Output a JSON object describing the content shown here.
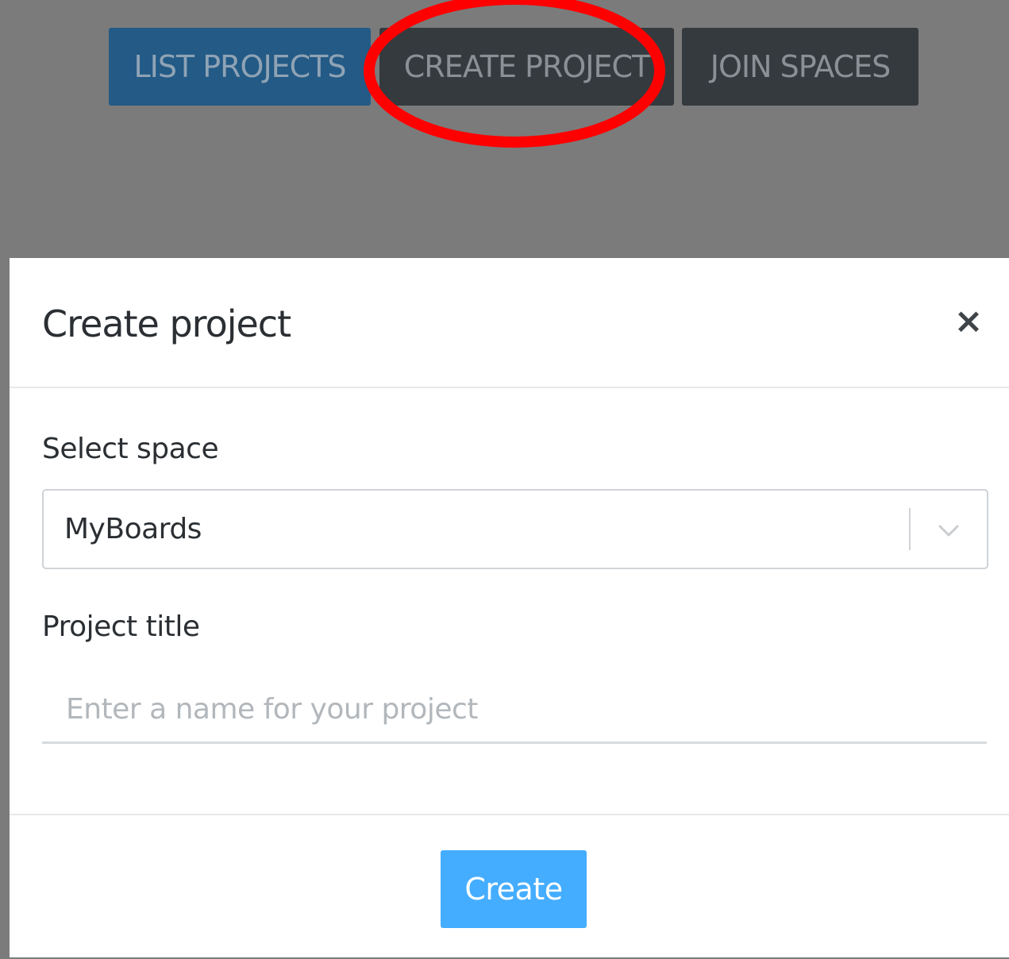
{
  "nav": {
    "list_projects": "LIST PROJECTS",
    "create_project": "CREATE PROJECT",
    "join_spaces": "JOIN SPACES"
  },
  "modal": {
    "title": "Create project",
    "close_label": "×",
    "space_label": "Select space",
    "space_value": "MyBoards",
    "project_title_label": "Project title",
    "project_title_placeholder": "Enter a name for your project",
    "project_title_value": "",
    "create_label": "Create"
  },
  "colors": {
    "overlay": "#7b7b7b",
    "nav_primary": "#235a86",
    "nav_dark": "#353a3e",
    "create_button": "#45adff",
    "annotation": "#ff0000"
  },
  "icons": {
    "close": "close-icon",
    "select_chevron": "chevron-down-icon"
  },
  "annotation": {
    "highlighted_item": "CREATE PROJECT",
    "shape": "ellipse"
  }
}
